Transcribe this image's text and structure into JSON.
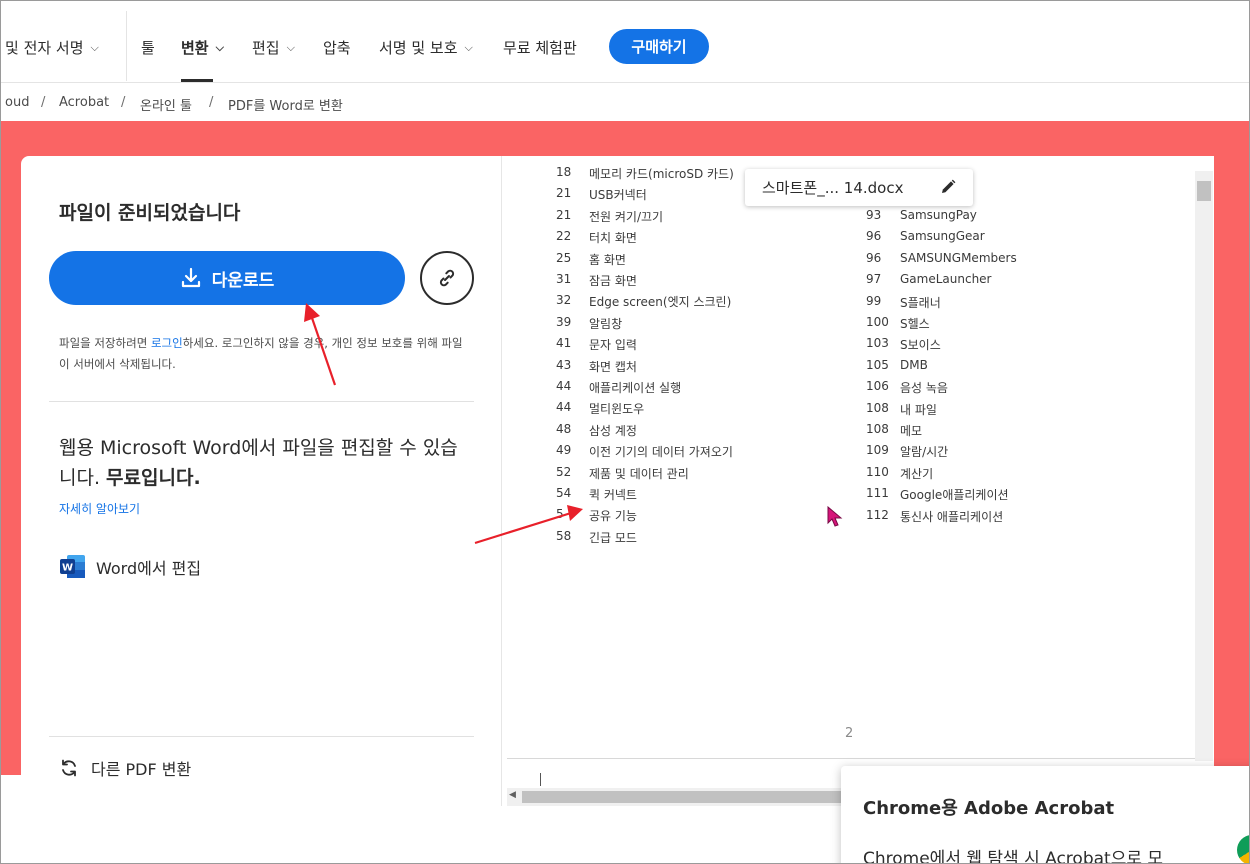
{
  "nav": {
    "items": [
      {
        "label": "및 전자 서명",
        "chevron": true
      },
      {
        "label": "툴",
        "chevron": false
      },
      {
        "label": "변환",
        "chevron": true,
        "active": true
      },
      {
        "label": "편집",
        "chevron": true
      },
      {
        "label": "압축",
        "chevron": false
      },
      {
        "label": "서명 및 보호",
        "chevron": true
      },
      {
        "label": "무료 체험판",
        "chevron": false
      }
    ],
    "buy_label": "구매하기"
  },
  "breadcrumb": [
    "oud",
    "Acrobat",
    "온라인 툴",
    "PDF를 Word로 변환"
  ],
  "left": {
    "title": "파일이 준비되었습니다",
    "download_label": "다운로드",
    "save_note_pre": "파일을 저장하려면 ",
    "save_note_link": "로그인",
    "save_note_post": "하세요. 로그인하지 않을 경우, 개인 정보 보호를 위해 파일이 서버에서 삭제됩니다.",
    "promo_text": "웹용 Microsoft Word에서 파일을 편집할 수 있습니다. ",
    "promo_bold": "무료입니다.",
    "learn_more": "자세히 알아보기",
    "word_edit": "Word에서 편집",
    "convert_other": "다른 PDF 변환"
  },
  "preview": {
    "file_name": "스마트폰_... 14.docx",
    "page_number": "2",
    "left_column": [
      {
        "num": "18",
        "text": "메모리 카드(microSD 카드)"
      },
      {
        "num": "21",
        "text": "USB커넥터"
      },
      {
        "num": "21",
        "text": "전원 켜기/끄기"
      },
      {
        "num": "22",
        "text": "터치 화면"
      },
      {
        "num": "25",
        "text": "홈 화면"
      },
      {
        "num": "31",
        "text": "잠금 화면"
      },
      {
        "num": "32",
        "text": "Edge screen(엣지 스크린)"
      },
      {
        "num": "39",
        "text": "알림창"
      },
      {
        "num": "41",
        "text": "문자 입력"
      },
      {
        "num": "43",
        "text": "화면 캡처"
      },
      {
        "num": "44",
        "text": "애플리케이션 실행"
      },
      {
        "num": "44",
        "text": "멀티윈도우"
      },
      {
        "num": "48",
        "text": "삼성 계정"
      },
      {
        "num": "49",
        "text": "이전 기기의 데이터 가져오기"
      },
      {
        "num": "52",
        "text": "제품 및 데이터 관리"
      },
      {
        "num": "54",
        "text": "퀵 커넥트"
      },
      {
        "num": "5",
        "text": "공유 기능"
      },
      {
        "num": "58",
        "text": "긴급 모드"
      }
    ],
    "right_column": [
      {
        "num": "93",
        "text": "SamsungPay"
      },
      {
        "num": "96",
        "text": "SamsungGear"
      },
      {
        "num": "96",
        "text": "SAMSUNGMembers"
      },
      {
        "num": "97",
        "text": "GameLauncher"
      },
      {
        "num": "99",
        "text": "S플래너"
      },
      {
        "num": "100",
        "text": "S헬스"
      },
      {
        "num": "103",
        "text": "S보이스"
      },
      {
        "num": "105",
        "text": "DMB"
      },
      {
        "num": "106",
        "text": "음성 녹음"
      },
      {
        "num": "108",
        "text": "내 파일"
      },
      {
        "num": "108",
        "text": "메모"
      },
      {
        "num": "109",
        "text": "알람/시간"
      },
      {
        "num": "110",
        "text": "계산기"
      },
      {
        "num": "111",
        "text": "Google애플리케이션"
      },
      {
        "num": "112",
        "text": "통신사 애플리케이션"
      }
    ]
  },
  "chrome_promo": {
    "title": "Chrome용 Adobe Acrobat",
    "description": "Chrome에서 웹 탐색 시 Acrobat으로 모"
  },
  "colors": {
    "accent": "#1473e6",
    "band": "#fa6464",
    "annotation_arrow": "#e8202a"
  }
}
